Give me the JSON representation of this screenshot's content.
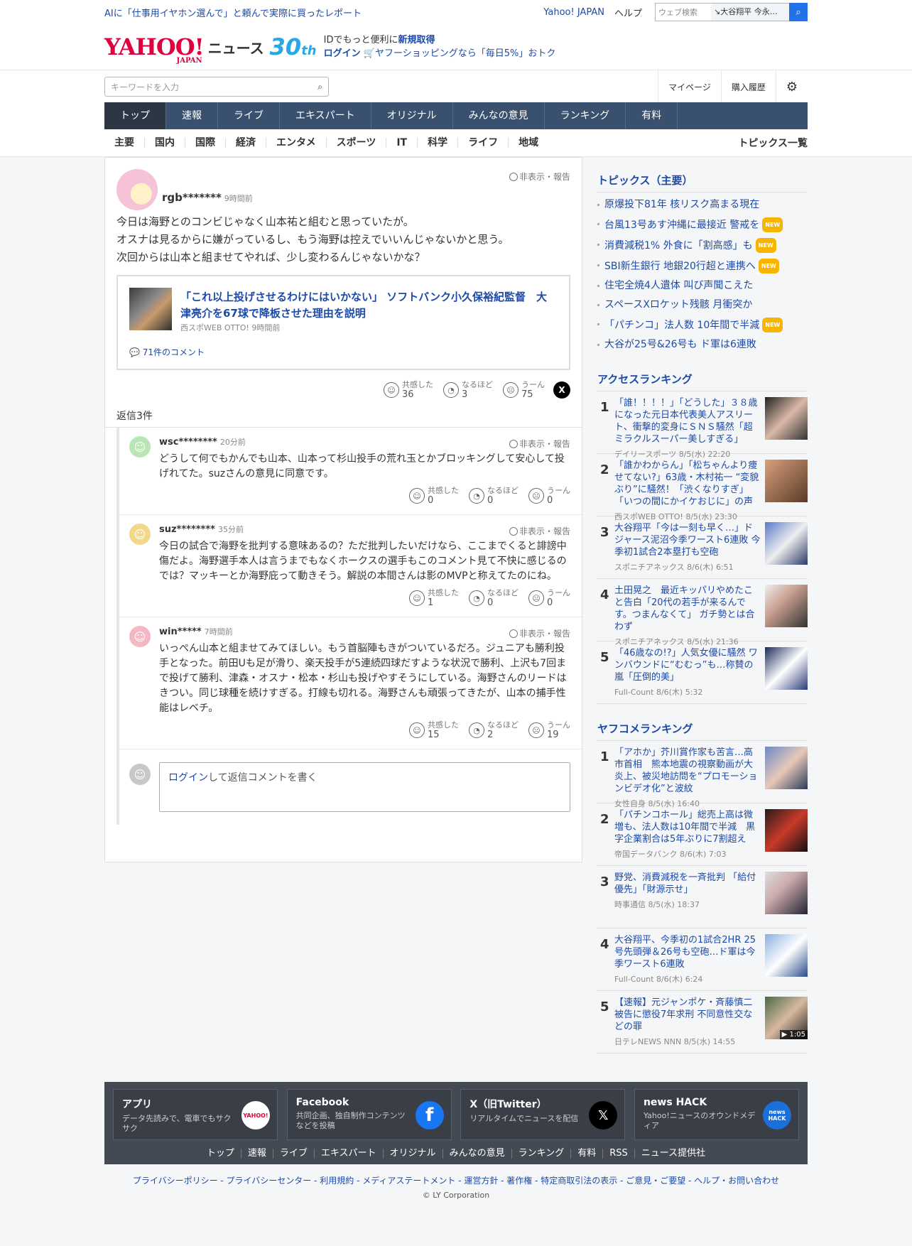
{
  "topbar": {
    "promo": "AIに「仕事用イヤホン選んで」と頼んで実際に買ったレポート",
    "yahoo_japan": "Yahoo! JAPAN",
    "help": "ヘルプ",
    "web_search_placeholder": "ウェブ検索",
    "web_search_keyword": "大谷翔平 今永…"
  },
  "header": {
    "logo": "YAHOO!",
    "logo_sub": "JAPAN",
    "news": "ニュース",
    "anniv": "30",
    "anniv_sfx": "th",
    "id_line_pre": "IDでもっと便利に",
    "id_signup": "新規取得",
    "login": "ログイン",
    "shopping": "ヤフーショッピングなら「毎日5%」おトク"
  },
  "search": {
    "placeholder": "キーワードを入力",
    "mypage": "マイページ",
    "history": "購入履歴"
  },
  "nav": {
    "items": [
      "トップ",
      "速報",
      "ライブ",
      "エキスパート",
      "オリジナル",
      "みんなの意見",
      "ランキング",
      "有料"
    ]
  },
  "subnav": {
    "items": [
      "主要",
      "国内",
      "国際",
      "経済",
      "エンタメ",
      "スポーツ",
      "IT",
      "科学",
      "ライフ",
      "地域"
    ],
    "topics_list": "トピックス一覧"
  },
  "parent": {
    "user": "rgb*******",
    "time": "9時間前",
    "hide": "非表示・報告",
    "lines": [
      "今日は海野とのコンビじゃなく山本祐と組むと思っていたが。",
      "オスナは見るからに嫌がっているし、もう海野は控えでいいんじゃないかと思う。",
      "次回からは山本と組ませてやれば、少し変わるんじゃないかな？"
    ],
    "article": {
      "title": "「これ以上投げさせるわけにはいかない」 ソフトバンク小久保裕紀監督　大津亮介を67球で降板させた理由を説明",
      "source": "西スポWEB OTTO! 9時間前",
      "comments": "71件のコメント"
    },
    "reactions": [
      {
        "label": "共感した",
        "count": "36"
      },
      {
        "label": "なるほど",
        "count": "3"
      },
      {
        "label": "うーん",
        "count": "75"
      }
    ]
  },
  "reply_header": "返信3件",
  "replies": [
    {
      "user": "wsc********",
      "time": "20分前",
      "hide": "非表示・報告",
      "text": "どうして何でもかんでも山本、山本って杉山投手の荒れ玉とかブロッキングして安心して投げれてた。suzさんの意見に同意です。",
      "reactions": [
        {
          "label": "共感した",
          "count": "0"
        },
        {
          "label": "なるほど",
          "count": "0"
        },
        {
          "label": "うーん",
          "count": "0"
        }
      ]
    },
    {
      "user": "suz********",
      "time": "35分前",
      "hide": "非表示・報告",
      "text": "今日の試合で海野を批判する意味あるの？ただ批判したいだけなら、ここまでくると誹謗中傷だよ。海野選手本人は言うまでもなくホークスの選手もこのコメント見て不快に感じるのでは？マッキーとか海野庇って動きそう。解説の本間さんは影のMVPと称えてたのにね。",
      "reactions": [
        {
          "label": "共感した",
          "count": "1"
        },
        {
          "label": "なるほど",
          "count": "0"
        },
        {
          "label": "うーん",
          "count": "0"
        }
      ]
    },
    {
      "user": "win*****",
      "time": "7時間前",
      "hide": "非表示・報告",
      "text": "いっぺん山本と組ませてみてほしい。もう首脳陣もきがついているだろ。ジュニアも勝利投手となった。前田Uも足が滑り、楽天投手が5連続四球だすような状況で勝利、上沢も7回まで投げて勝利、津森・オスナ・松本・杉山も投げやすそうにしている。海野さんのリードはきつい。同じ球種を続けすぎる。打線も切れる。海野さんも頑張ってきたが、山本の捕手性能はレベチ。",
      "reactions": [
        {
          "label": "共感した",
          "count": "15"
        },
        {
          "label": "なるほど",
          "count": "2"
        },
        {
          "label": "うーん",
          "count": "19"
        }
      ]
    }
  ],
  "login_reply": {
    "login": "ログイン",
    "rest": "して返信コメントを書く"
  },
  "topics": {
    "heading": "トピックス（主要）",
    "items": [
      {
        "t": "原爆投下81年 核リスク高まる現在",
        "new": ""
      },
      {
        "t": "台風13号あす沖縄に最接近 警戒を",
        "new": "NEW"
      },
      {
        "t": "消費減税1% 外食に「割高感」も",
        "new": "NEW"
      },
      {
        "t": "SBI新生銀行 地銀20行超と連携へ",
        "new": "NEW"
      },
      {
        "t": "住宅全焼4人遺体 叫び声聞こえた",
        "new": ""
      },
      {
        "t": "スペースXロケット残骸 月衝突か",
        "new": ""
      },
      {
        "t": "「パチンコ」法人数 10年間で半減",
        "new": "NEW"
      },
      {
        "t": "大谷が25号&26号も ド軍は6連敗",
        "new": ""
      }
    ]
  },
  "access": {
    "heading": "アクセスランキング",
    "items": [
      {
        "n": "1",
        "t": "「誰！！！！」「どうした」３８歳になった元日本代表美人アスリート、衝撃的変身にＳＮＳ騒然「超ミラクルスーパー美しすぎる」",
        "s": "デイリースポーツ 8/5(水) 22:20"
      },
      {
        "n": "2",
        "t": "「誰かわからん」「松ちゃんより痩せてない?」63歳・木村祐一 “変貌ぶり”に騒然！「渋くなりすぎ」「いつの間にかイケおじに」の声",
        "s": "西スポWEB OTTO! 8/5(水) 23:30"
      },
      {
        "n": "3",
        "t": "大谷翔平「今は一刻も早く…」ドジャース泥沼今季ワースト6連敗 今季初1試合2本塁打も空砲",
        "s": "スポニチアネックス 8/6(木) 6:51"
      },
      {
        "n": "4",
        "t": "土田晃之　最近キッパリやめたこと告白「20代の若手が来るんです。つまんなくて」 ガチ勢とは合わず",
        "s": "スポニチアネックス 8/5(水) 21:36"
      },
      {
        "n": "5",
        "t": "「46歳なの!?」人気女優に騒然 ワンバウンドに“むむっ”も…称賛の嵐「圧倒的美」",
        "s": "Full-Count 8/6(木) 5:32"
      }
    ]
  },
  "yafukome": {
    "heading": "ヤフコメランキング",
    "items": [
      {
        "n": "1",
        "t": "「アホか」芥川賞作家も苦言…高市首相　熊本地震の視察動画が大炎上、被災地訪問を“プロモーションビデオ化”と波紋",
        "s": "女性自身 8/5(水) 16:40"
      },
      {
        "n": "2",
        "t": "「パチンコホール」総売上高は微増も、法人数は10年間で半減　黒字企業割合は5年ぶりに7割超え",
        "s": "帝国データバンク 8/6(木) 7:03"
      },
      {
        "n": "3",
        "t": "野党、消費減税を一斉批判 「給付優先」「財源示せ」",
        "s": "時事通信 8/5(水) 18:37"
      },
      {
        "n": "4",
        "t": "大谷翔平、今季初の1試合2HR 25号先頭弾＆26号も空砲…ド軍は今季ワースト6連敗",
        "s": "Full-Count 8/6(木) 6:24"
      },
      {
        "n": "5",
        "t": "【速報】元ジャンポケ・斉藤慎二被告に懲役7年求刑 不同意性交などの罪",
        "s": "日テレNEWS NNN 8/5(水) 14:55",
        "badge": "▶ 1:05"
      }
    ]
  },
  "footer": {
    "cards": [
      {
        "t": "アプリ",
        "d": "データ先読みで、電車でもサクサク"
      },
      {
        "t": "Facebook",
        "d": "共同企画、独自制作コンテンツなどを投稿"
      },
      {
        "t": "X（旧Twitter）",
        "d": "リアルタイムでニュースを配信"
      },
      {
        "t": "news HACK",
        "d": "Yahoo!ニュースのオウンドメディア"
      }
    ],
    "app_icon": "YAHOO!",
    "hack_icon": "news HACK",
    "links": [
      "トップ",
      "速報",
      "ライブ",
      "エキスパート",
      "オリジナル",
      "みんなの意見",
      "ランキング",
      "有料",
      "RSS",
      "ニュース提供社"
    ],
    "legal": "プライバシーポリシー - プライバシーセンター - 利用規約 - メディアステートメント - 運営方針 - 著作権 - 特定商取引法の表示 - ご意見・ご要望 - ヘルプ・お問い合わせ",
    "copyright": "© LY Corporation"
  },
  "colors": {
    "link": "#1d4aa8",
    "nav_bg": "#39516f",
    "nav_active": "#2c3644",
    "brand": "#e0003e",
    "new_badge": "#f8b500",
    "footer_bg": "#444a53"
  }
}
